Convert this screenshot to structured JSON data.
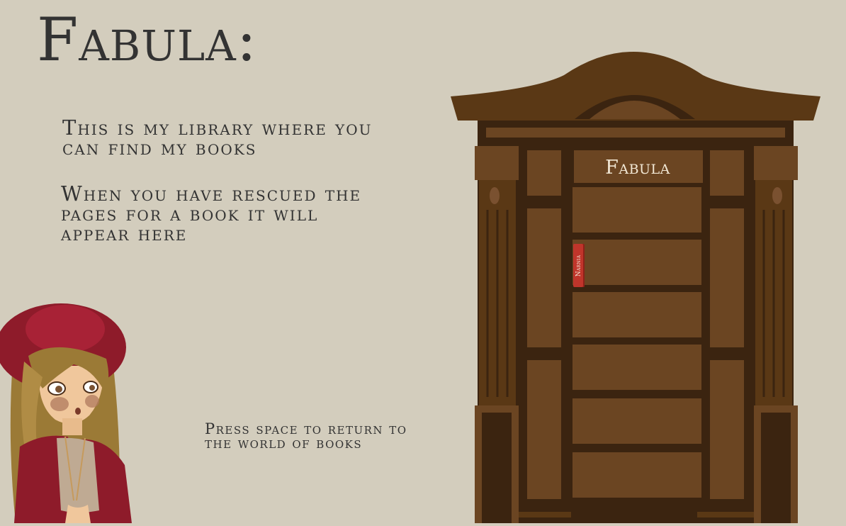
{
  "title": "Fabula:",
  "intro": {
    "line1": "This is my library where you can find my books",
    "line2": "When you have rescued the pages for a book it will appear here"
  },
  "hint": "Press space to return to the world of books",
  "bookcase": {
    "label": "Fabula",
    "books": [
      {
        "title": "Narnia",
        "color": "#c0352b"
      }
    ]
  },
  "colors": {
    "background": "#d3cdbd",
    "wood_dark": "#3b2410",
    "wood_mid": "#5a3815",
    "wood_panel": "#6b4522",
    "book_red": "#c0352b"
  },
  "character": {
    "name": "librarian-girl",
    "hat_color": "#8e1b2a"
  }
}
